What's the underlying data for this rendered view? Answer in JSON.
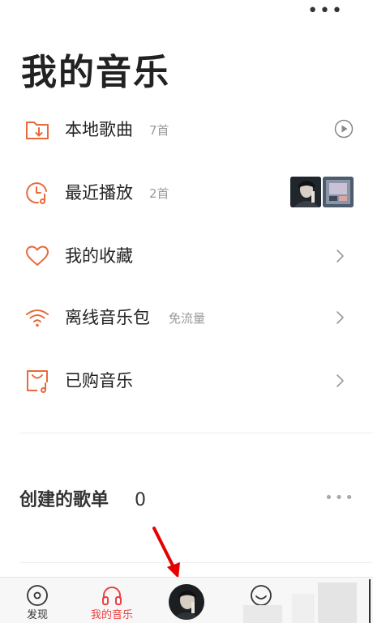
{
  "colors": {
    "accent": "#ec4141",
    "icon_orange": "#e86a3a",
    "text": "#222222",
    "muted": "#9a9a9a",
    "annotation": "#e60000"
  },
  "header": {
    "more_icon": "more-horizontal-icon",
    "title": "我的音乐"
  },
  "menu": {
    "items": [
      {
        "label": "本地歌曲",
        "sub": "7首",
        "icon": "folder-download-icon",
        "trailing": "play-circle-icon"
      },
      {
        "label": "最近播放",
        "sub": "2首",
        "icon": "clock-music-icon",
        "trailing": "recent-thumbnails"
      },
      {
        "label": "我的收藏",
        "sub": "",
        "icon": "heart-icon",
        "trailing": "chevron-right-icon"
      },
      {
        "label": "离线音乐包",
        "sub": "免流量",
        "icon": "wifi-icon",
        "trailing": "chevron-right-icon"
      },
      {
        "label": "已购音乐",
        "sub": "",
        "icon": "shopping-bag-music-icon",
        "trailing": "chevron-right-icon"
      }
    ]
  },
  "playlists": {
    "title": "创建的歌单",
    "count": "0",
    "more_icon": "more-horizontal-icon"
  },
  "tabbar": {
    "tabs": [
      {
        "label": "发现",
        "icon": "disc-icon",
        "active": false
      },
      {
        "label": "我的音乐",
        "icon": "headphones-icon",
        "active": true
      },
      {
        "label": "",
        "icon": "now-playing-avatar",
        "active": false
      },
      {
        "label": "",
        "icon": "smiley-icon",
        "active": false
      }
    ]
  }
}
